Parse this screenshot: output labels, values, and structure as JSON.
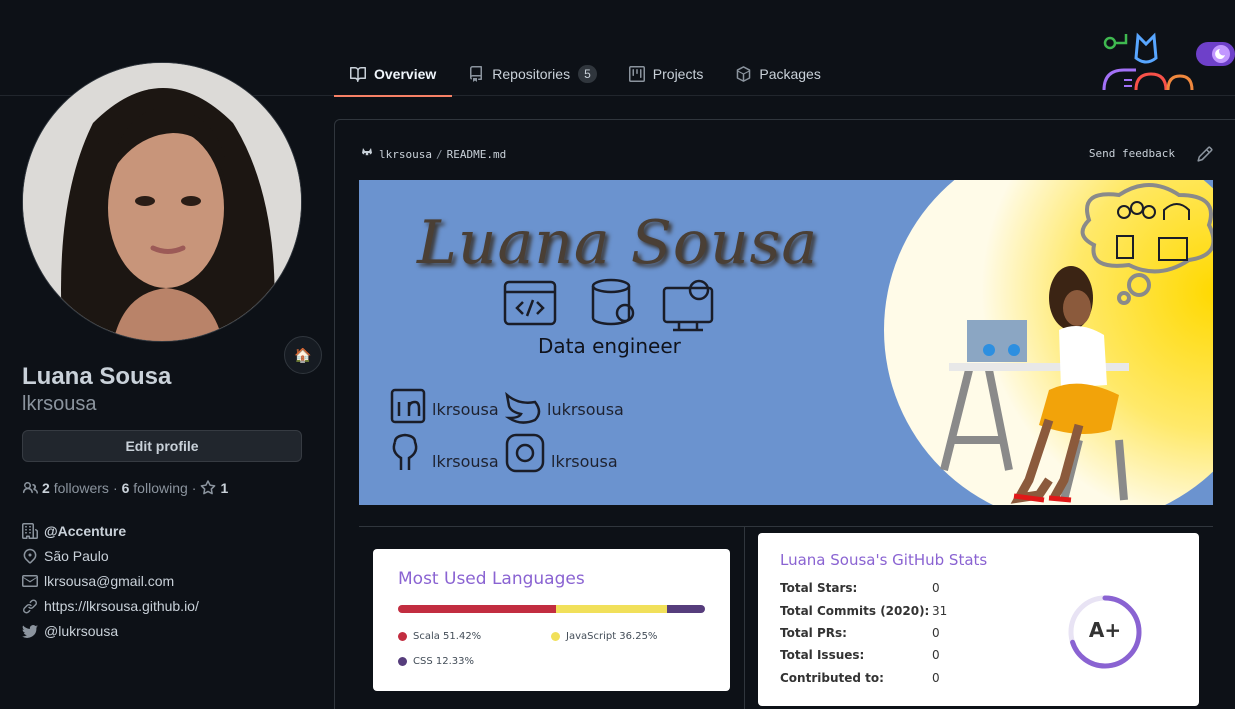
{
  "tabs": [
    {
      "label": "Overview",
      "icon": "book-icon",
      "active": true
    },
    {
      "label": "Repositories",
      "icon": "repo-icon",
      "count": "5"
    },
    {
      "label": "Projects",
      "icon": "project-icon"
    },
    {
      "label": "Packages",
      "icon": "package-icon"
    }
  ],
  "profile": {
    "name": "Luana Sousa",
    "login": "lkrsousa",
    "edit_label": "Edit profile",
    "followers_count": "2",
    "followers_label": "followers",
    "following_count": "6",
    "following_label": "following",
    "stars_count": "1",
    "separator": "·"
  },
  "details": {
    "company": "@Accenture",
    "location": "São Paulo",
    "email": "lkrsousa@gmail.com",
    "website": "https://lkrsousa.github.io/",
    "twitter": "@lukrsousa"
  },
  "readme": {
    "owner": "lkrsousa",
    "sep": "/",
    "file": "README.md",
    "feedback": "Send feedback"
  },
  "banner": {
    "title": "Luana Sousa",
    "subtitle": "Data engineer",
    "linkedin": "lkrsousa",
    "twitter": "lukrsousa",
    "github": "lkrsousa",
    "instagram": "lkrsousa"
  },
  "languages": {
    "title": "Most Used Languages",
    "items": [
      {
        "name": "Scala 51.42%",
        "percent": 51.42,
        "color": "#c22d40"
      },
      {
        "name": "JavaScript 36.25%",
        "percent": 36.25,
        "color": "#f1e05a"
      },
      {
        "name": "CSS 12.33%",
        "percent": 12.33,
        "color": "#563d7c"
      }
    ]
  },
  "stats": {
    "title": "Luana Sousa's GitHub Stats",
    "rows": [
      {
        "label": "Total Stars:",
        "value": "0"
      },
      {
        "label": "Total Commits (2020):",
        "value": "31"
      },
      {
        "label": "Total PRs:",
        "value": "0"
      },
      {
        "label": "Total Issues:",
        "value": "0"
      },
      {
        "label": "Contributed to:",
        "value": "0"
      }
    ],
    "rank": "A+",
    "rank_progress": 0.7
  },
  "colors": {
    "accent_tab": "#f78166",
    "card_title": "#8a63d2",
    "banner_bg": "#6b93cf"
  }
}
